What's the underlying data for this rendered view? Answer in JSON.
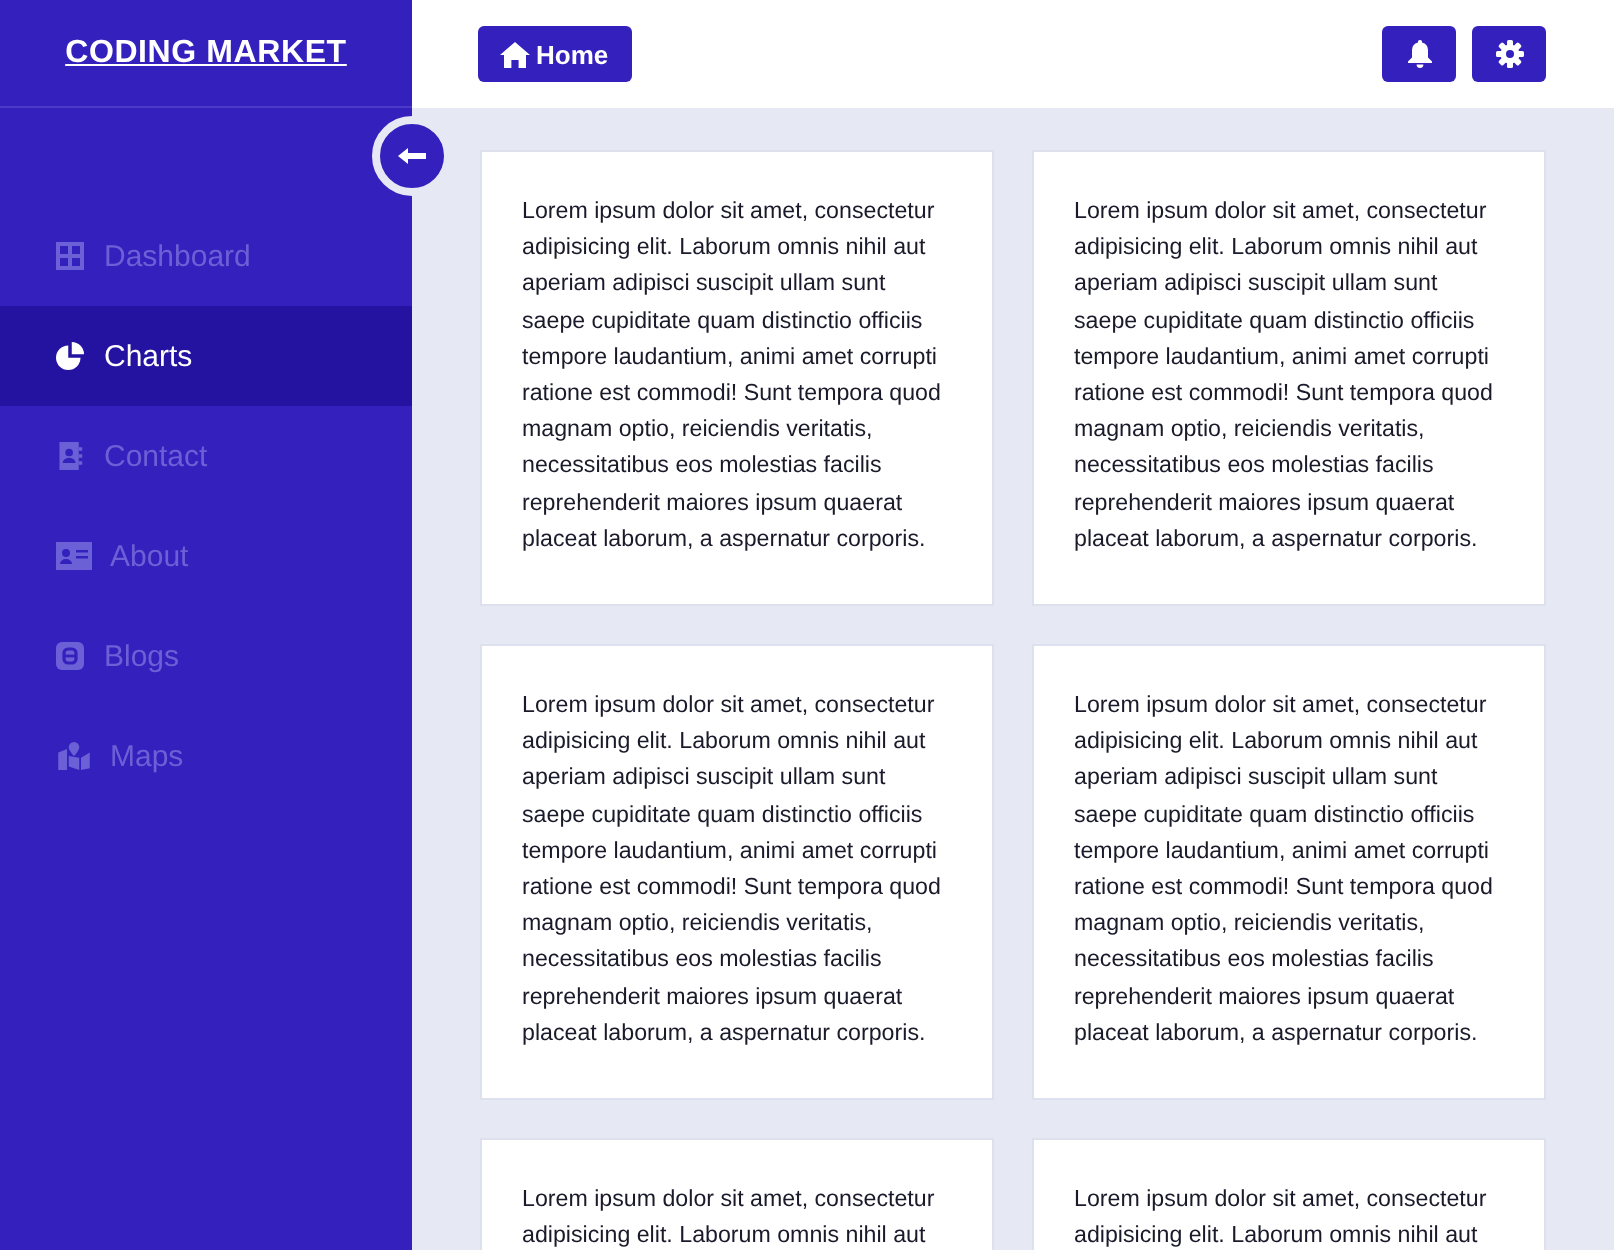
{
  "brand": "CODING MARKET",
  "header": {
    "home_button": "Home"
  },
  "sidebar": {
    "items": [
      {
        "label": "Dashboard",
        "kind": "grid",
        "selected": false
      },
      {
        "label": "Charts",
        "kind": "pie",
        "selected": true
      },
      {
        "label": "Contact",
        "kind": "contact",
        "selected": false
      },
      {
        "label": "About",
        "kind": "card",
        "selected": false
      },
      {
        "label": "Blogs",
        "kind": "blog",
        "selected": false
      },
      {
        "label": "Maps",
        "kind": "map",
        "selected": false
      }
    ]
  },
  "cards": [
    {
      "text": "Lorem ipsum dolor sit amet, consectetur adipisicing elit. Laborum omnis nihil aut aperiam adipisci suscipit ullam sunt saepe cupiditate quam distinctio officiis tempore laudantium, animi amet corrupti ratione est commodi! Sunt tempora quod magnam optio, reiciendis veritatis, necessitatibus eos molestias facilis reprehenderit maiores ipsum quaerat placeat laborum, a aspernatur corporis."
    },
    {
      "text": "Lorem ipsum dolor sit amet, consectetur adipisicing elit. Laborum omnis nihil aut aperiam adipisci suscipit ullam sunt saepe cupiditate quam distinctio officiis tempore laudantium, animi amet corrupti ratione est commodi! Sunt tempora quod magnam optio, reiciendis veritatis, necessitatibus eos molestias facilis reprehenderit maiores ipsum quaerat placeat laborum, a aspernatur corporis."
    },
    {
      "text": "Lorem ipsum dolor sit amet, consectetur adipisicing elit. Laborum omnis nihil aut aperiam adipisci suscipit ullam sunt saepe cupiditate quam distinctio officiis tempore laudantium, animi amet corrupti ratione est commodi! Sunt tempora quod magnam optio, reiciendis veritatis, necessitatibus eos molestias facilis reprehenderit maiores ipsum quaerat placeat laborum, a aspernatur corporis."
    },
    {
      "text": "Lorem ipsum dolor sit amet, consectetur adipisicing elit. Laborum omnis nihil aut aperiam adipisci suscipit ullam sunt saepe cupiditate quam distinctio officiis tempore laudantium, animi amet corrupti ratione est commodi! Sunt tempora quod magnam optio, reiciendis veritatis, necessitatibus eos molestias facilis reprehenderit maiores ipsum quaerat placeat laborum, a aspernatur corporis."
    },
    {
      "text": "Lorem ipsum dolor sit amet, consectetur adipisicing elit. Laborum omnis nihil aut"
    },
    {
      "text": "Lorem ipsum dolor sit amet, consectetur adipisicing elit. Laborum omnis nihil aut"
    }
  ]
}
